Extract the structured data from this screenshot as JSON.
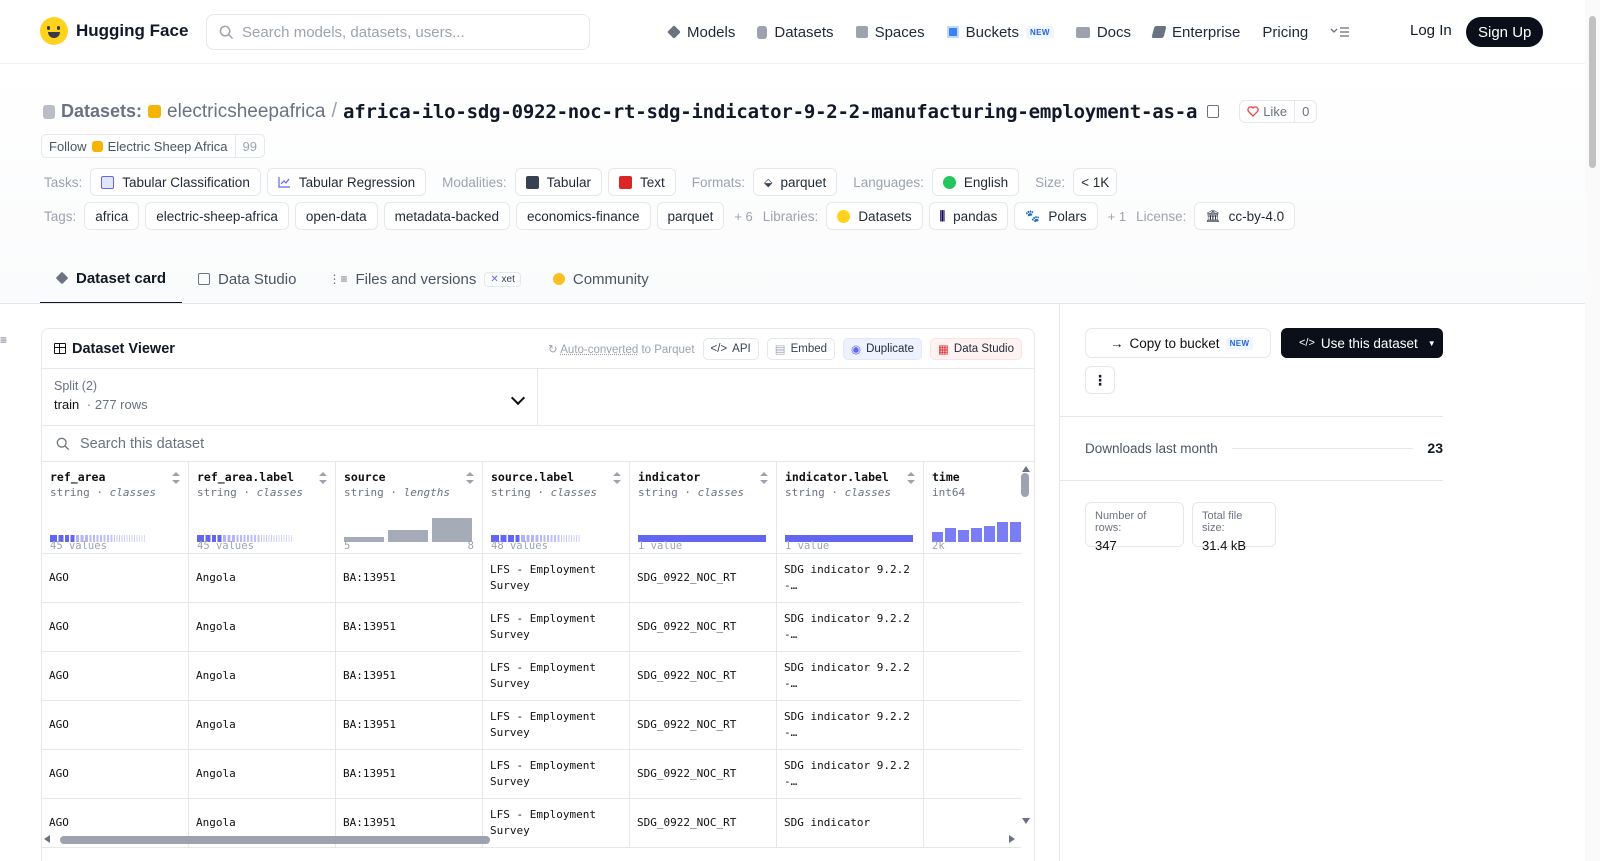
{
  "nav": {
    "brand": "Hugging Face",
    "search_placeholder": "Search models, datasets, users...",
    "items": [
      {
        "label": "Models",
        "icon": "models-icon",
        "color": "#6b7280"
      },
      {
        "label": "Datasets",
        "icon": "datasets-icon",
        "color": "#9ca3af"
      },
      {
        "label": "Spaces",
        "icon": "spaces-icon",
        "color": "#9ca3af"
      },
      {
        "label": "Buckets",
        "icon": "buckets-icon",
        "color": "#3b82f6",
        "badge": "NEW"
      },
      {
        "label": "Docs",
        "icon": "docs-icon",
        "color": "#9ca3af"
      },
      {
        "label": "Enterprise",
        "icon": "enterprise-icon",
        "color": "#6b7280"
      },
      {
        "label": "Pricing"
      }
    ],
    "login": "Log In",
    "signup": "Sign Up"
  },
  "header": {
    "crumb_label": "Datasets:",
    "org": "electricsheepafrica",
    "slash": "/",
    "name": "africa-ilo-sdg-0922-noc-rt-sdg-indicator-9-2-2-manufacturing-employment-as-a",
    "like_label": "Like",
    "like_count": "0",
    "follow_label": "Follow",
    "follow_org": "Electric Sheep Africa",
    "follow_count": "99"
  },
  "meta": {
    "tasks_label": "Tasks:",
    "tasks": [
      "Tabular Classification",
      "Tabular Regression"
    ],
    "modalities_label": "Modalities:",
    "modalities": [
      "Tabular",
      "Text"
    ],
    "formats_label": "Formats:",
    "formats": [
      "parquet"
    ],
    "languages_label": "Languages:",
    "languages": [
      "English"
    ],
    "size_label": "Size:",
    "size": "< 1K",
    "tags_label": "Tags:",
    "tags": [
      "africa",
      "electric-sheep-africa",
      "open-data",
      "metadata-backed",
      "economics-finance",
      "parquet"
    ],
    "tags_more": "+ 6",
    "libraries_label": "Libraries:",
    "libraries": [
      "Datasets",
      "pandas",
      "Polars"
    ],
    "libraries_more": "+ 1",
    "license_label": "License:",
    "license": "cc-by-4.0"
  },
  "tabs": [
    {
      "label": "Dataset card",
      "active": true
    },
    {
      "label": "Data Studio"
    },
    {
      "label": "Files and versions",
      "badge": "xet"
    },
    {
      "label": "Community"
    }
  ],
  "viewer": {
    "title": "Dataset Viewer",
    "autoconv_link": "Auto-converted",
    "autoconv_rest": " to Parquet",
    "btn_api": "API",
    "btn_embed": "Embed",
    "btn_duplicate": "Duplicate",
    "btn_studio": "Data Studio",
    "split_label": "Split (2)",
    "split_value": "train",
    "split_rows": "277 rows",
    "search_placeholder": "Search this dataset",
    "columns": [
      {
        "name": "ref_area",
        "type": "string",
        "kind": "classes",
        "foot_left": "45 values",
        "foot_right": ""
      },
      {
        "name": "ref_area.label",
        "type": "string",
        "kind": "classes",
        "foot_left": "45 values",
        "foot_right": ""
      },
      {
        "name": "source",
        "type": "string",
        "kind": "lengths",
        "foot_left": "5",
        "foot_right": "8"
      },
      {
        "name": "source.label",
        "type": "string",
        "kind": "classes",
        "foot_left": "48 values",
        "foot_right": ""
      },
      {
        "name": "indicator",
        "type": "string",
        "kind": "classes",
        "foot_left": "1 value",
        "foot_right": ""
      },
      {
        "name": "indicator.label",
        "type": "string",
        "kind": "classes",
        "foot_left": "1 value",
        "foot_right": ""
      },
      {
        "name": "time",
        "type": "int64",
        "kind": "",
        "foot_left": "2k",
        "foot_right": ""
      }
    ],
    "rows": [
      [
        "AGO",
        "Angola",
        "BA:13951",
        "LFS - Employment Survey",
        "SDG_0922_NOC_RT",
        "SDG indicator 9.2.2 -…",
        ""
      ],
      [
        "AGO",
        "Angola",
        "BA:13951",
        "LFS - Employment Survey",
        "SDG_0922_NOC_RT",
        "SDG indicator 9.2.2 -…",
        ""
      ],
      [
        "AGO",
        "Angola",
        "BA:13951",
        "LFS - Employment Survey",
        "SDG_0922_NOC_RT",
        "SDG indicator 9.2.2 -…",
        ""
      ],
      [
        "AGO",
        "Angola",
        "BA:13951",
        "LFS - Employment Survey",
        "SDG_0922_NOC_RT",
        "SDG indicator 9.2.2 -…",
        ""
      ],
      [
        "AGO",
        "Angola",
        "BA:13951",
        "LFS - Employment Survey",
        "SDG_0922_NOC_RT",
        "SDG indicator 9.2.2 -…",
        ""
      ],
      [
        "AGO",
        "Angola",
        "BA:13951",
        "LFS - Employment Survey",
        "SDG_0922_NOC_RT",
        "SDG indicator",
        ""
      ]
    ]
  },
  "sidebar": {
    "copy_label": "Copy to bucket",
    "copy_badge": "NEW",
    "use_label": "Use this dataset",
    "downloads_label": "Downloads last month",
    "downloads_value": "23",
    "rows_label": "Number of rows:",
    "rows_value": "347",
    "size_label": "Total file size:",
    "size_value": "31.4 kB"
  },
  "colors": {
    "accent": "#6366f1",
    "bar_gray": "#9ca3af",
    "brand_yellow": "#ffd21e"
  }
}
